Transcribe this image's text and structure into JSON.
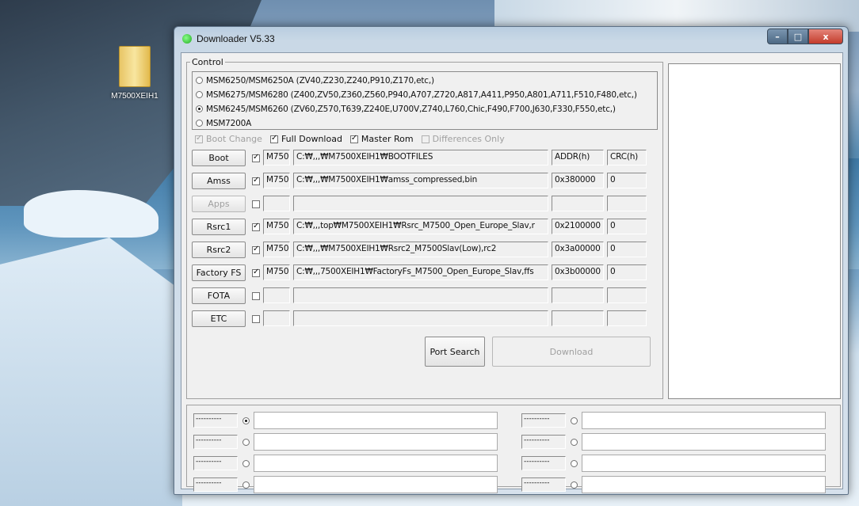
{
  "desktop": {
    "icon_label": "M7500XEIH1"
  },
  "window": {
    "title": "Downloader V5.33",
    "minimize": "–",
    "maximize": "□",
    "close": "x"
  },
  "control": {
    "legend": "Control",
    "chips": [
      {
        "label": "MSM6250/MSM6250A (ZV40,Z230,Z240,P910,Z170,etc,)",
        "selected": false
      },
      {
        "label": "MSM6275/MSM6280 (Z400,ZV50,Z360,Z560,P940,A707,Z720,A817,A411,P950,A801,A711,F510,F480,etc,)",
        "selected": false
      },
      {
        "label": "MSM6245/MSM6260 (ZV60,Z570,T639,Z240E,U700V,Z740,L760,Chic,F490,F700,J630,F330,F550,etc,)",
        "selected": true
      },
      {
        "label": "MSM7200A",
        "selected": false
      }
    ],
    "options": {
      "boot_change": {
        "label": "Boot Change",
        "checked": true,
        "enabled": false
      },
      "full_download": {
        "label": "Full Download",
        "checked": true
      },
      "master_rom": {
        "label": "Master Rom",
        "checked": true
      },
      "differences_only": {
        "label": "Differences Only",
        "checked": false,
        "enabled": false
      }
    },
    "rows": [
      {
        "button": "Boot",
        "checked": true,
        "enabled": true,
        "name": "M750(",
        "path": "C:₩,,,₩M7500XEIH1₩BOOTFILES",
        "addr": "ADDR(h)",
        "crc": "CRC(h)"
      },
      {
        "button": "Amss",
        "checked": true,
        "enabled": true,
        "name": "M750(",
        "path": "C:₩,,,₩M7500XEIH1₩amss_compressed,bin",
        "addr": "0x380000",
        "crc": "0"
      },
      {
        "button": "Apps",
        "checked": false,
        "enabled": false,
        "name": "",
        "path": "",
        "addr": "",
        "crc": ""
      },
      {
        "button": "Rsrc1",
        "checked": true,
        "enabled": true,
        "name": "M750(",
        "path": "C:₩,,,top₩M7500XEIH1₩Rsrc_M7500_Open_Europe_Slav,r",
        "addr": "0x2100000",
        "crc": "0"
      },
      {
        "button": "Rsrc2",
        "checked": true,
        "enabled": true,
        "name": "M750(",
        "path": "C:₩,,,₩M7500XEIH1₩Rsrc2_M7500Slav(Low),rc2",
        "addr": "0x3a00000",
        "crc": "0"
      },
      {
        "button": "Factory FS",
        "checked": true,
        "enabled": true,
        "name": "M750(",
        "path": "C:₩,,,7500XEIH1₩FactoryFs_M7500_Open_Europe_Slav,ffs",
        "addr": "0x3b00000",
        "crc": "0"
      },
      {
        "button": "FOTA",
        "checked": false,
        "enabled": true,
        "name": "",
        "path": "",
        "addr": "",
        "crc": ""
      },
      {
        "button": "ETC",
        "checked": false,
        "enabled": true,
        "name": "",
        "path": "",
        "addr": "",
        "crc": ""
      }
    ],
    "port_search": "Port Search",
    "download": "Download"
  },
  "ports": [
    {
      "label": "----------",
      "selected": true
    },
    {
      "label": "----------",
      "selected": false
    },
    {
      "label": "----------",
      "selected": false
    },
    {
      "label": "----------",
      "selected": false
    },
    {
      "label": "----------",
      "selected": false
    },
    {
      "label": "----------",
      "selected": false
    },
    {
      "label": "----------",
      "selected": false
    },
    {
      "label": "----------",
      "selected": false
    }
  ]
}
